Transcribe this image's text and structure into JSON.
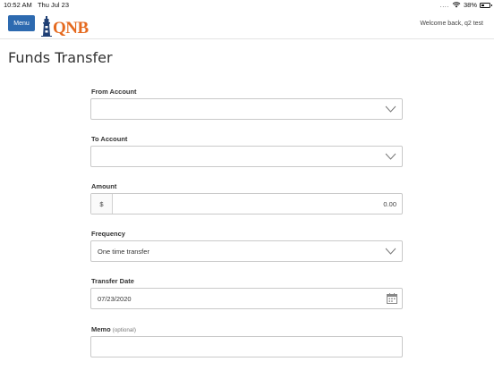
{
  "statusbar": {
    "time": "10:52 AM",
    "date": "Thu Jul 23",
    "signal": "....",
    "battery": "38%",
    "battery_level": 0.38
  },
  "header": {
    "menu_label": "Menu",
    "logo_text": "QNB",
    "welcome": "Welcome back, q2 test"
  },
  "page": {
    "title": "Funds Transfer"
  },
  "form": {
    "from_account": {
      "label": "From Account",
      "value": ""
    },
    "to_account": {
      "label": "To Account",
      "value": ""
    },
    "amount": {
      "label": "Amount",
      "prefix": "$",
      "value": "0.00"
    },
    "frequency": {
      "label": "Frequency",
      "value": "One time transfer"
    },
    "transfer_date": {
      "label": "Transfer Date",
      "value": "07/23/2020"
    },
    "memo": {
      "label": "Memo",
      "optional_label": "(optional)",
      "value": ""
    }
  },
  "colors": {
    "brand_blue": "#2d6ab0",
    "brand_orange": "#e56a1f",
    "border": "#c9c9c9"
  },
  "icons": [
    "wifi-icon",
    "battery-icon",
    "lighthouse-logo-icon",
    "chevron-down-icon",
    "calendar-icon"
  ]
}
